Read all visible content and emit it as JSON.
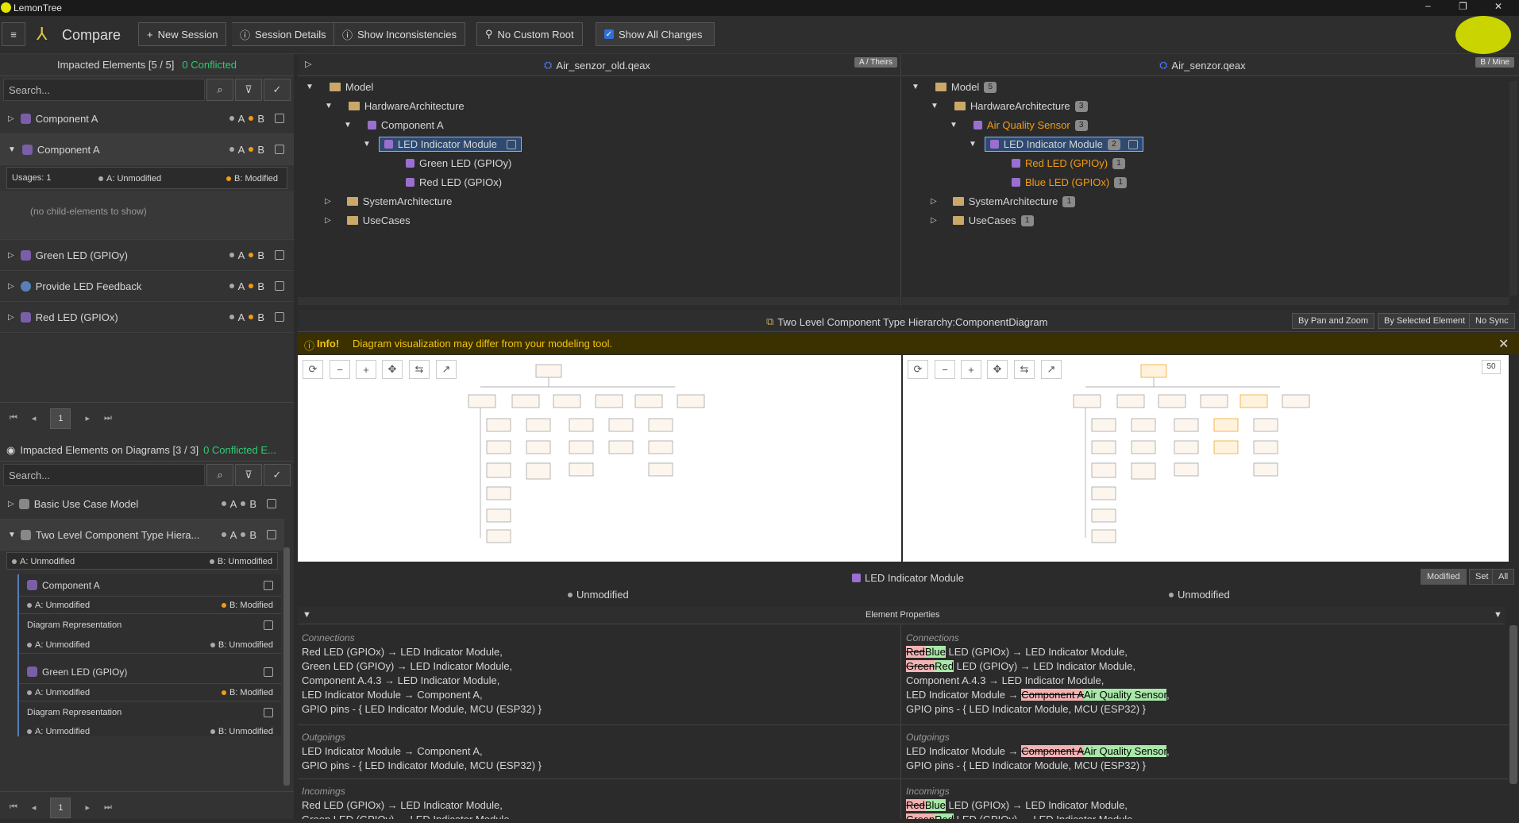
{
  "app": {
    "title": "LemonTree"
  },
  "toolbar": {
    "mode": "Compare",
    "new_session": "New Session",
    "session_details": "Session Details",
    "show_inconsistencies": "Show Inconsistencies",
    "no_custom_root": "No Custom Root",
    "show_all_changes": "Show All Changes"
  },
  "impacted": {
    "title": "Impacted Elements [5 / 5]",
    "conflicted": "0 Conflicted",
    "search_placeholder": "Search...",
    "items": [
      {
        "label": "Component A",
        "a": "A",
        "b": "B"
      },
      {
        "label": "Component A",
        "a": "A",
        "b": "B"
      },
      {
        "label": "Green LED (GPIOy)",
        "a": "A",
        "b": "B"
      },
      {
        "label": "Provide LED Feedback",
        "a": "A",
        "b": "B"
      },
      {
        "label": "Red LED (GPIOx)",
        "a": "A",
        "b": "B"
      }
    ],
    "usages": "Usages: 1",
    "a_status": "A: Unmodified",
    "b_status": "B: Modified",
    "no_children": "(no child-elements to show)",
    "page": "1"
  },
  "diagrams_panel": {
    "title": "Impacted Elements on Diagrams [3 / 3]",
    "conflicted": "0 Conflicted E...",
    "search_placeholder": "Search...",
    "items": [
      {
        "label": "Basic Use Case Model",
        "a": "A",
        "b": "B"
      },
      {
        "label": "Two Level Component Type Hiera...",
        "a": "A",
        "b": "B"
      }
    ],
    "a_unmod": "A: Unmodified",
    "b_unmod": "B: Unmodified",
    "b_mod": "B: Modified",
    "sub": [
      {
        "label": "Component A"
      },
      {
        "label": "Diagram Representation"
      },
      {
        "label": "Green LED (GPIOy)"
      },
      {
        "label": "Diagram Representation"
      }
    ],
    "page": "1"
  },
  "left_tree": {
    "file": "Air_senzor_old.qeax",
    "tag": "A / Theirs",
    "model": "Model",
    "hw": "HardwareArchitecture",
    "comp": "Component A",
    "led": "LED Indicator Module",
    "green": "Green LED (GPIOy)",
    "red": "Red LED (GPIOx)",
    "sys": "SystemArchitecture",
    "uc": "UseCases"
  },
  "right_tree": {
    "file": "Air_senzor.qeax",
    "tag": "B / Mine",
    "model": "Model",
    "model_n": "5",
    "hw": "HardwareArchitecture",
    "hw_n": "3",
    "comp": "Air Quality Sensor",
    "comp_n": "3",
    "led": "LED Indicator Module",
    "led_n": "2",
    "red": "Red LED (GPIOy)",
    "red_n": "1",
    "blue": "Blue LED (GPIOx)",
    "blue_n": "1",
    "sys": "SystemArchitecture",
    "sys_n": "1",
    "uc": "UseCases",
    "uc_n": "1"
  },
  "diagram": {
    "title": "Two Level Component Type Hierarchy:ComponentDiagram",
    "by_pan": "By Pan and Zoom",
    "by_sel": "By Selected Element",
    "no_sync": "No Sync",
    "info_bold": "Info!",
    "info_text": "Diagram visualization may differ from your modeling tool.",
    "zoom": "50"
  },
  "element": {
    "title": "LED Indicator Module",
    "left_status": "Unmodified",
    "right_status": "Unmodified",
    "modified": "Modified",
    "set": "Set",
    "all": "All",
    "props_title": "Element Properties",
    "connections_cap": "Connections",
    "outgoings_cap": "Outgoings",
    "incomings_cap": "Incomings",
    "l_conn": [
      "Red LED (GPIOx) → LED Indicator Module,",
      "Green LED (GPIOy) → LED Indicator Module,",
      "Component A.4.3 → LED Indicator Module,",
      "LED Indicator Module → Component A,",
      "GPIO pins - { LED Indicator Module, MCU (ESP32) }"
    ],
    "l_out": [
      "LED Indicator Module → Component A,",
      "GPIO pins - { LED Indicator Module, MCU (ESP32) }"
    ],
    "l_in": [
      "Red LED (GPIOx) → LED Indicator Module,",
      "Green LED (GPIOy) → LED Indicator Module,"
    ],
    "r": {
      "red": "Red",
      "blue": "Blue",
      "green": "Green",
      "red2": "Red",
      "rest1": " LED (GPIOx) → LED Indicator Module,",
      "rest2": " LED (GPIOy) → LED Indicator Module,",
      "line3": "Component A.4.3 → LED Indicator Module,",
      "pre4": "LED Indicator Module → ",
      "compA": "Component A",
      "aqs": "Air Quality Sensor",
      "comma": ",",
      "line5": "GPIO pins - { LED Indicator Module, MCU (ESP32) }"
    }
  }
}
